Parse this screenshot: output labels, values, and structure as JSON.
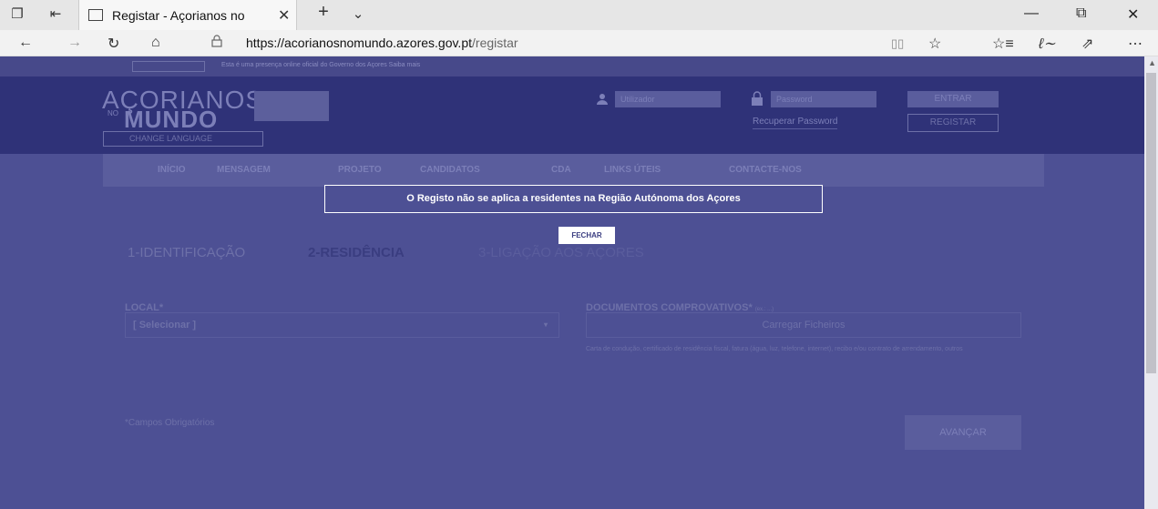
{
  "browser": {
    "tab_title": "Registar - Açorianos no",
    "url_host": "https://acorianosnomundo.azores.gov.pt",
    "url_path": "/registar"
  },
  "govbar": {
    "text": "Esta é uma presença online oficial do Governo dos Açores Saiba mais"
  },
  "header": {
    "brand_line1": "AÇORIANOS",
    "brand_no": "NO",
    "brand_line2": "MUNDO",
    "change_language": "CHANGE LANGUAGE",
    "user_placeholder": "Utilizador",
    "password_placeholder": "Password",
    "login_label": "ENTRAR",
    "recover_label": "Recuperar Password",
    "register_label": "REGISTAR"
  },
  "nav": {
    "items": [
      "INÍCIO",
      "MENSAGEM",
      "PROJETO",
      "CANDIDATOS",
      "CDA",
      "LINKS ÚTEIS",
      "CONTACTE-NOS"
    ]
  },
  "steps": [
    "1-IDENTIFICAÇÃO",
    "2-RESIDÊNCIA",
    "3-LIGAÇÃO AOS AÇORES"
  ],
  "form": {
    "local_label": "LOCAL*",
    "local_value": "[ Selecionar ]",
    "docs_label": "DOCUMENTOS COMPROVATIVOS*",
    "docs_hint": "(ex.: ...)",
    "upload_label": "Carregar Ficheiros",
    "docs_help": "Carta de condução, certificado de residência fiscal, fatura (água, luz, telefone, internet), recibo e/ou contrato de arrendamento, outros",
    "required_note": "*Campos Obrigatórios",
    "next_label": "AVANÇAR"
  },
  "modal": {
    "message": "O Registo não se aplica a residentes na Região Autónoma dos Açores",
    "close_label": "FECHAR"
  },
  "colors": {
    "overlay": "#4d5094",
    "header": "#2f3278",
    "modal_border": "#ffffff"
  }
}
